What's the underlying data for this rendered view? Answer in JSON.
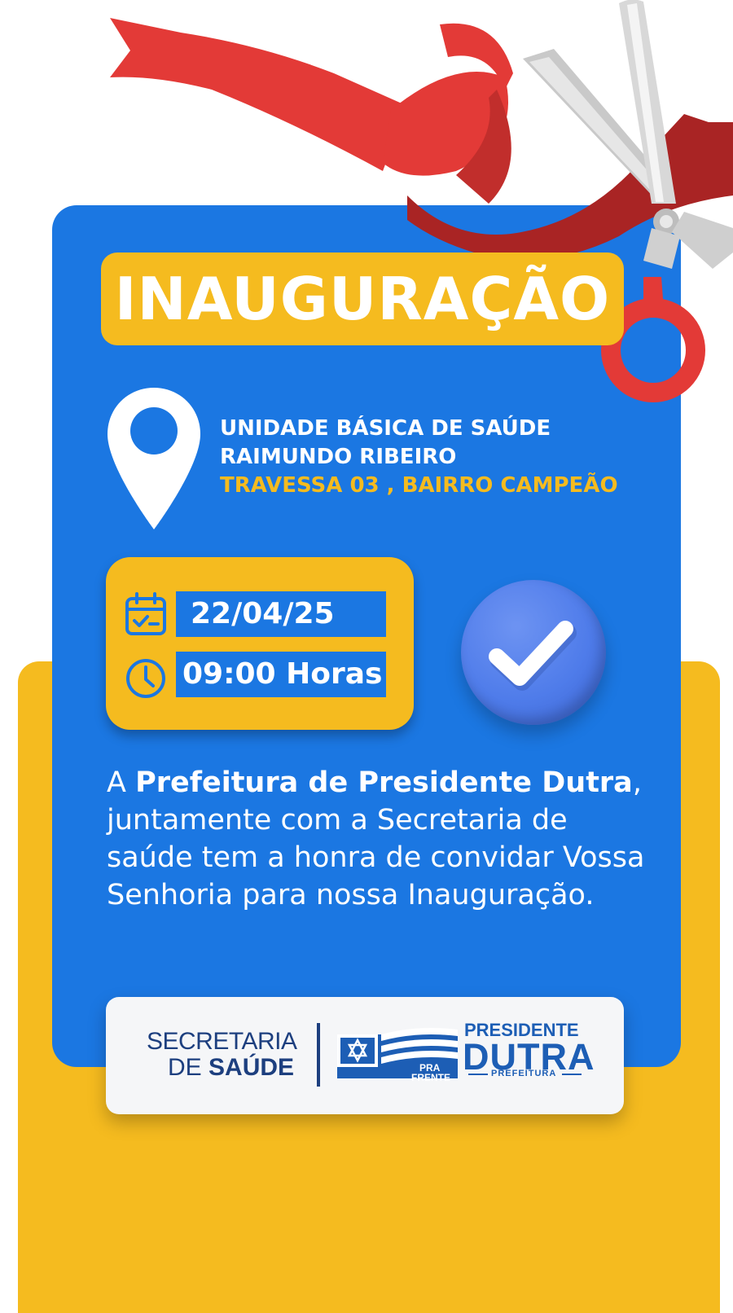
{
  "title": "INAUGURAÇÃO",
  "location": {
    "line1": "UNIDADE BÁSICA DE SAÚDE",
    "line2": "RAIMUNDO RIBEIRO",
    "address": "TRAVESSA 03 , BAIRRO CAMPEÃO"
  },
  "event": {
    "date": "22/04/25",
    "time": "09:00 Horas"
  },
  "message": {
    "prefix": "A ",
    "bold": "Prefeitura de Presidente Dutra",
    "rest": ", juntamente com a Secretaria de saúde tem a honra de convidar Vossa Senhoria para nossa Inauguração."
  },
  "logos": {
    "secretaria_line1": "SECRETARIA",
    "secretaria_line2_prefix": "DE ",
    "secretaria_line2_bold": "SAÚDE",
    "pra_frente_line1": "PRA",
    "pra_frente_line2": "FRENTE",
    "presidente": "PRESIDENTE",
    "dutra": "DUTRA",
    "prefeitura": "PREFEITURA"
  },
  "icons": {
    "pin": "location-pin-icon",
    "calendar": "calendar-icon",
    "clock": "clock-icon",
    "check": "checkmark-icon",
    "scissors": "scissors-icon",
    "ribbon": "red-ribbon"
  },
  "colors": {
    "blue": "#1B77E2",
    "yellow": "#F5BB1F",
    "red": "#E33A37",
    "navy": "#1D3F7F"
  }
}
